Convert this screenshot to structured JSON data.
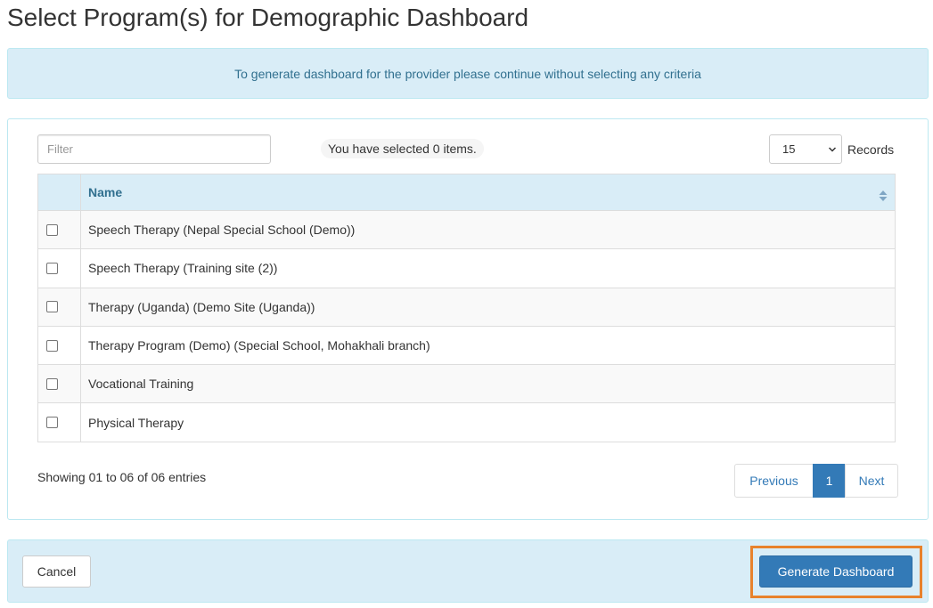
{
  "page": {
    "title": "Select Program(s) for Demographic Dashboard"
  },
  "alert": {
    "message": "To generate dashboard for the provider please continue without selecting any criteria"
  },
  "toolbar": {
    "filter_placeholder": "Filter",
    "filter_value": "",
    "selected_text": "You have selected 0 items.",
    "records_value": "15",
    "records_label": "Records"
  },
  "table": {
    "columns": [
      "",
      "Name"
    ],
    "rows": [
      {
        "name": "Speech Therapy (Nepal Special School (Demo))",
        "checked": false
      },
      {
        "name": "Speech Therapy (Training site (2))",
        "checked": false
      },
      {
        "name": "Therapy (Uganda) (Demo Site (Uganda))",
        "checked": false
      },
      {
        "name": "Therapy Program (Demo) (Special School, Mohakhali branch)",
        "checked": false
      },
      {
        "name": "Vocational Training",
        "checked": false
      },
      {
        "name": "Physical Therapy",
        "checked": false
      }
    ]
  },
  "footer_info": {
    "entries_text": "Showing 01 to 06 of 06 entries"
  },
  "pagination": {
    "previous_label": "Previous",
    "current_page": "1",
    "next_label": "Next"
  },
  "actions": {
    "cancel_label": "Cancel",
    "generate_label": "Generate Dashboard"
  },
  "colors": {
    "info_bg": "#d9edf7",
    "info_text": "#31708f",
    "primary": "#337ab7",
    "highlight": "#e8822c"
  },
  "icons": {
    "records_select": "chevron-down-icon",
    "sort": "sort-icon"
  }
}
